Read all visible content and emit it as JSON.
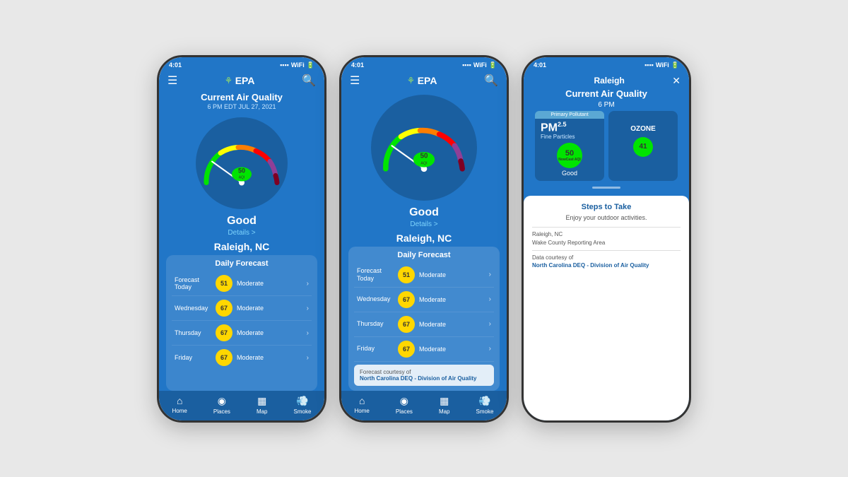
{
  "screens": [
    {
      "id": "screen1",
      "status_time": "4:01",
      "title": "Current Air Quality",
      "subtitle": "6 PM EDT  JUL 27, 2021",
      "aqi_value": "50",
      "aqi_label": "AQI",
      "quality": "Good",
      "details_text": "Details >",
      "location": "Raleigh, NC",
      "forecast_title": "Daily Forecast",
      "forecast": [
        {
          "day": "Forecast Today",
          "aqi": "51",
          "condition": "Moderate",
          "badge_class": "aqi-yellow"
        },
        {
          "day": "Wednesday",
          "aqi": "67",
          "condition": "Moderate",
          "badge_class": "aqi-yellow"
        },
        {
          "day": "Thursday",
          "aqi": "67",
          "condition": "Moderate",
          "badge_class": "aqi-yellow"
        },
        {
          "day": "Friday",
          "aqi": "67",
          "condition": "Moderate",
          "badge_class": "aqi-yellow"
        }
      ],
      "nav": [
        "Home",
        "Places",
        "Map",
        "Smoke"
      ]
    },
    {
      "id": "screen2",
      "status_time": "4:01",
      "aqi_value": "50",
      "aqi_label": "AQI",
      "quality": "Good",
      "details_text": "Details >",
      "location": "Raleigh, NC",
      "forecast_title": "Daily Forecast",
      "forecast": [
        {
          "day": "Forecast Today",
          "aqi": "51",
          "condition": "Moderate",
          "badge_class": "aqi-yellow"
        },
        {
          "day": "Wednesday",
          "aqi": "67",
          "condition": "Moderate",
          "badge_class": "aqi-yellow"
        },
        {
          "day": "Thursday",
          "aqi": "67",
          "condition": "Moderate",
          "badge_class": "aqi-yellow"
        },
        {
          "day": "Friday",
          "aqi": "67",
          "condition": "Moderate",
          "badge_class": "aqi-yellow"
        }
      ],
      "forecast_courtesy": "Forecast courtesy of",
      "forecast_source": "North Carolina DEQ - Division of Air Quality",
      "nav": [
        "Home",
        "Places",
        "Map",
        "Smoke"
      ]
    },
    {
      "id": "screen3",
      "status_time": "4:01",
      "modal_location": "Raleigh",
      "close_label": "✕",
      "current_aq_label": "Current Air Quality",
      "time_label": "6 PM",
      "primary_pollutant_badge": "Primary Pollutant",
      "pollutant_name": "PM",
      "pollutant_sub": "2.5",
      "pollutant_desc": "Fine Particles",
      "pollutant_aqi": "50",
      "pollutant_aqi_sub": "NowCast AQI",
      "pollutant_quality": "Good",
      "ozone_label": "OZONE",
      "ozone_value": "41",
      "steps_title": "Steps to Take",
      "steps_desc": "Enjoy your outdoor activities.",
      "info1_line1": "Raleigh, NC",
      "info1_line2": "Wake County Reporting Area",
      "info2_label": "Data courtesy of",
      "info2_source": "North Carolina DEQ - Division of Air Quality"
    }
  ],
  "icons": {
    "menu": "☰",
    "search": "🔍",
    "epa_symbol": "⚘",
    "home": "⌂",
    "places": "◉",
    "map": "▦",
    "smoke": "💨",
    "chevron": "›"
  }
}
